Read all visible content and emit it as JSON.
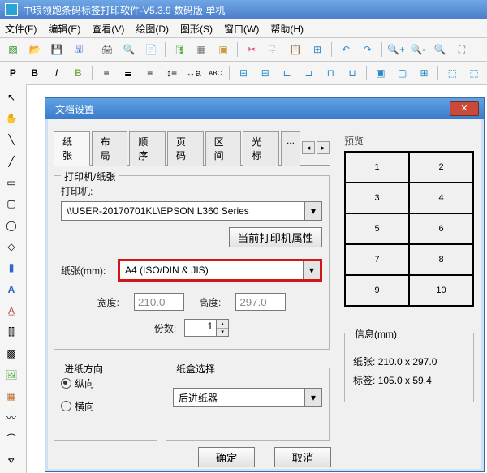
{
  "titlebar": {
    "title": "中琅领跑条码标签打印软件-V5.3.9 数码版 单机"
  },
  "menus": {
    "file": "文件(F)",
    "edit": "编辑(E)",
    "view": "查看(V)",
    "draw": "绘图(D)",
    "shape": "图形(S)",
    "window": "窗口(W)",
    "help": "帮助(H)"
  },
  "dialog": {
    "title": "文档设置",
    "tabs": {
      "paper": "纸张",
      "layout": "布局",
      "order": "顺序",
      "page": "页码",
      "range": "区间",
      "cursor": "光标",
      "more": "..."
    },
    "printer_section": {
      "legend": "打印机/纸张",
      "printer_label": "打印机:",
      "printer_value": "\\\\USER-20170701KL\\EPSON L360 Series",
      "printer_props": "当前打印机属性",
      "paper_label": "纸张(mm):",
      "paper_value": "A4 (ISO/DIN & JIS)",
      "width_label": "宽度:",
      "width_value": "210.0",
      "height_label": "高度:",
      "height_value": "297.0",
      "copies_label": "份数:",
      "copies_value": "1"
    },
    "feed_section": {
      "legend": "进纸方向",
      "portrait": "纵向",
      "landscape": "横向"
    },
    "tray_section": {
      "legend": "纸盒选择",
      "tray_value": "后进纸器"
    },
    "preview": "预览",
    "info": {
      "legend": "信息(mm)",
      "paper_line_label": "纸张:",
      "paper_line_value": "210.0 x 297.0",
      "label_line_label": "标签:",
      "label_line_value": "105.0 x 59.4"
    },
    "ok": "确定",
    "cancel": "取消"
  },
  "cells": [
    "1",
    "2",
    "3",
    "4",
    "5",
    "6",
    "7",
    "8",
    "9",
    "10"
  ]
}
